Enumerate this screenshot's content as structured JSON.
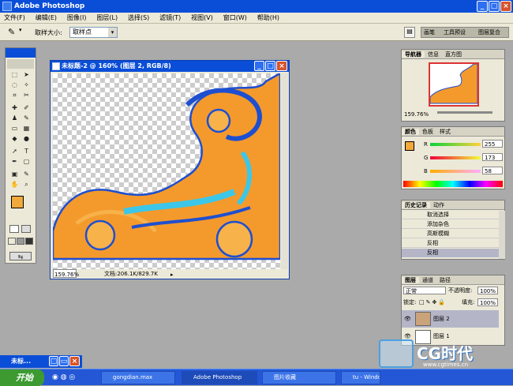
{
  "app": {
    "title": "Adobe Photoshop"
  },
  "menu": [
    "文件(F)",
    "编辑(E)",
    "图像(I)",
    "图层(L)",
    "选择(S)",
    "滤镜(T)",
    "视图(V)",
    "窗口(W)",
    "帮助(H)"
  ],
  "options": {
    "sample_label": "取样大小:",
    "sample_value": "取样点"
  },
  "dock": {
    "tabs": [
      "画笔",
      "工具预设",
      "图层复合"
    ]
  },
  "document": {
    "title": "未标题-2 @ 160% (图层 2, RGB/8)",
    "zoom": "159.76%",
    "file_info": "文档:206.1K/829.7K"
  },
  "navigator": {
    "tabs": [
      "导航器",
      "信息",
      "直方图"
    ],
    "zoom": "159.76%"
  },
  "color": {
    "tabs": [
      "颜色",
      "色板",
      "样式"
    ],
    "r_label": "R",
    "g_label": "G",
    "b_label": "B",
    "r": "255",
    "g": "173",
    "b": "58",
    "fg": "#f2a93b",
    "bg": "#1fd21f"
  },
  "history": {
    "tabs": [
      "历史记录",
      "动作"
    ],
    "items": [
      "取消选择",
      "添加杂色",
      "高斯模糊",
      "反相",
      "反相"
    ]
  },
  "layers": {
    "tabs": [
      "图层",
      "通道",
      "路径"
    ],
    "blend_mode": "正常",
    "opacity_label": "不透明度:",
    "opacity": "100%",
    "lock_label": "锁定:",
    "fill_label": "填充:",
    "fill": "100%",
    "items": [
      "图层 2",
      "图层 1"
    ]
  },
  "minidoc": {
    "title": "未标..."
  },
  "taskbar": {
    "start": "开始",
    "tasks": [
      "gongdian.max",
      "Adobe Photoshop",
      "图片收藏",
      "tu - Windows 图..."
    ]
  },
  "watermark": {
    "brand": "CG时代",
    "url": "www.cgtimes.cn"
  }
}
